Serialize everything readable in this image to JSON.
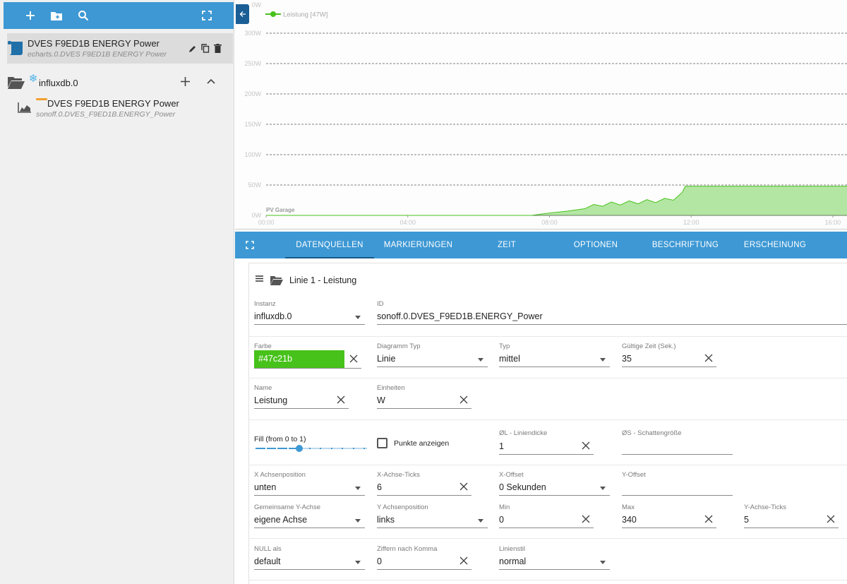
{
  "sidebar": {
    "items": [
      {
        "title": "DVES F9ED1B ENERGY Power",
        "subtitle": "echarts.0.DVES F9ED1B ENERGY Power"
      },
      {
        "title": "influxdb.0"
      },
      {
        "title": "DVES F9ED1B ENERGY Power",
        "subtitle": "sonoff.0.DVES_F9ED1B.ENERGY_Power"
      }
    ]
  },
  "chart": {
    "legend": "Leistung [47W]",
    "series_label": "PV Garage",
    "y_ticks": [
      "0W",
      "50W",
      "100W",
      "150W",
      "200W",
      "250W",
      "300W"
    ],
    "y_top_tick": "0W",
    "x_ticks": [
      "00:00",
      "04:00",
      "08:00",
      "12:00",
      "16:00"
    ]
  },
  "chart_data": {
    "type": "area",
    "title": "",
    "xlabel": "",
    "ylabel": "",
    "ylim": [
      0,
      340
    ],
    "xlim_hours": [
      0,
      16.4
    ],
    "x_ticks": [
      "00:00",
      "04:00",
      "08:00",
      "12:00",
      "16:00"
    ],
    "y_ticks": [
      "0W",
      "50W",
      "100W",
      "150W",
      "200W",
      "250W",
      "300W"
    ],
    "legend": "top-left",
    "grid": true,
    "series": [
      {
        "name": "Leistung [47W]",
        "color": "#47c21b",
        "x": [
          "00:00",
          "07:30",
          "08:00",
          "08:30",
          "09:00",
          "09:15",
          "09:30",
          "09:45",
          "10:00",
          "10:15",
          "10:30",
          "10:45",
          "11:00",
          "11:15",
          "11:30",
          "11:45",
          "11:50",
          "12:00",
          "13:00",
          "14:00",
          "15:00",
          "16:00",
          "16:25"
        ],
        "values": [
          0,
          0,
          4,
          7,
          11,
          18,
          15,
          22,
          17,
          24,
          19,
          26,
          21,
          28,
          25,
          38,
          48,
          48,
          48,
          48,
          48,
          48,
          48
        ]
      }
    ]
  },
  "tabs": [
    "DATENQUELLEN",
    "MARKIERUNGEN",
    "ZEIT",
    "OPTIONEN",
    "BESCHRIFTUNG",
    "ERSCHEINUNG"
  ],
  "line": {
    "title": "Linie 1 - Leistung"
  },
  "form": {
    "instanz": {
      "label": "Instanz",
      "value": "influxdb.0"
    },
    "id": {
      "label": "ID",
      "value": "sonoff.0.DVES_F9ED1B.ENERGY_Power"
    },
    "farbe": {
      "label": "Farbe",
      "value": "#47c21b",
      "color": "#47c21b"
    },
    "diagramm_typ": {
      "label": "Diagramm Typ",
      "value": "Linie"
    },
    "typ": {
      "label": "Typ",
      "value": "mittel"
    },
    "gueltige_zeit": {
      "label": "Gültige Zeit (Sek.)",
      "value": "35"
    },
    "name": {
      "label": "Name",
      "value": "Leistung"
    },
    "einheiten": {
      "label": "Einheiten",
      "value": "W"
    },
    "fill": {
      "label": "Fill (from 0 to 1)",
      "value": 0.4
    },
    "punkte": {
      "label": "Punkte anzeigen",
      "checked": false
    },
    "liniendicke": {
      "label": "ØL - Liniendicke",
      "value": "1"
    },
    "schatten": {
      "label": "ØS - Schattengröße",
      "value": ""
    },
    "x_achsenposition": {
      "label": "X Achsenposition",
      "value": "unten"
    },
    "x_achse_ticks": {
      "label": "X-Achse-Ticks",
      "value": "6"
    },
    "x_offset": {
      "label": "X-Offset",
      "value": "0 Sekunden"
    },
    "y_offset": {
      "label": "Y-Offset",
      "value": ""
    },
    "gemeinsame_y": {
      "label": "Gemeinsame Y-Achse",
      "value": "eigene Achse"
    },
    "y_achsenposition": {
      "label": "Y Achsenposition",
      "value": "links"
    },
    "min": {
      "label": "Min",
      "value": "0"
    },
    "max": {
      "label": "Max",
      "value": "340"
    },
    "y_achse_ticks": {
      "label": "Y-Achse-Ticks",
      "value": "5"
    },
    "null_als": {
      "label": "NULL als",
      "value": "default"
    },
    "ziffern": {
      "label": "Ziffern nach Komma",
      "value": "0"
    },
    "linienstil": {
      "label": "Linienstil",
      "value": "normal"
    }
  }
}
